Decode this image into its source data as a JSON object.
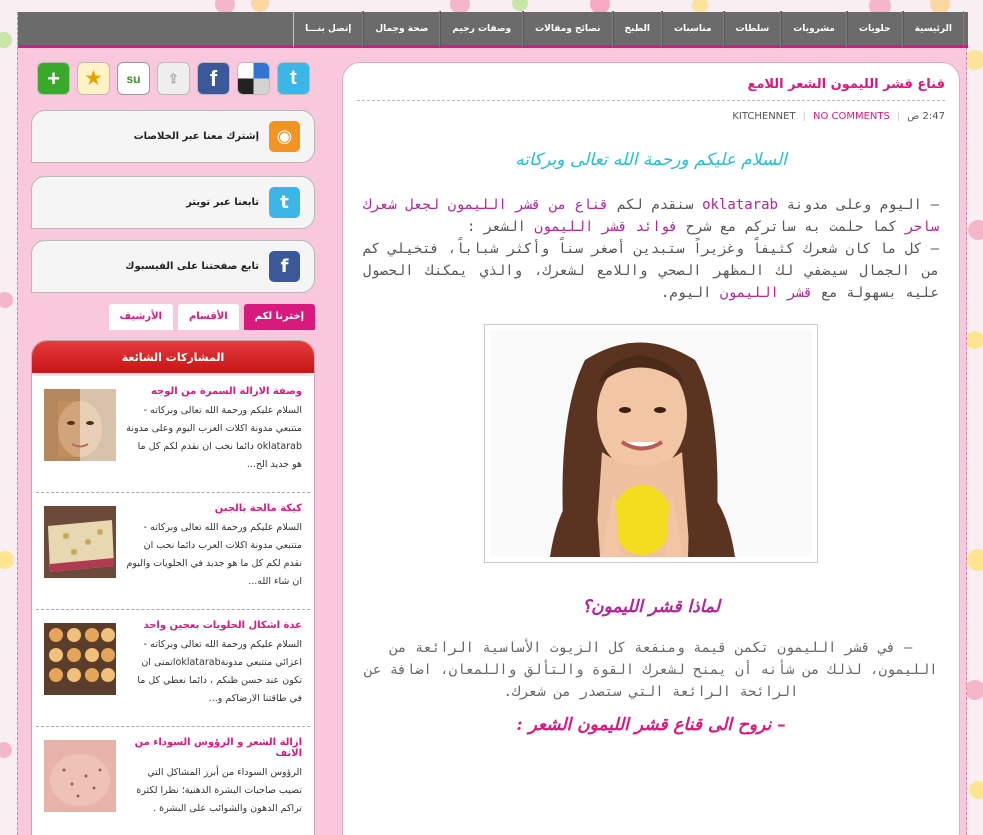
{
  "nav": {
    "items": [
      "الرئيسية",
      "حلويات",
      "مشروبات",
      "سلطات",
      "مناسبات",
      "الطبخ",
      "نصائح ومقالات",
      "وصفات رجيم",
      "صحة وجمال",
      "إتصل بنـــا"
    ]
  },
  "post": {
    "title": "قناع قشر الليمون الشعر اللامع",
    "time": "2:47 ص",
    "author": "KITCHENNET",
    "comments": "NO COMMENTS",
    "greeting": "السلام عليكم ورحمة الله تعالى وبركاته",
    "p1_a": "– اليوم وعلى مدونة ",
    "p1_blog": "oklatarab",
    "p1_b": " سنقدم لكم ",
    "p1_link1": "قناع من قشر الليمون لجعل شعرك ساحر",
    "p1_c": " كما حلمت به ساتركم مع شرح ",
    "p1_link2": "فوائد قشر الليمون",
    "p1_d": " الشعر :",
    "p2_a": "– كل ما كان شعرك كثيفاً وغزيراً ستبدين أصغر سناً وأكثر شباباً، فتخيلي كم من الجمال سيضفي لك المظهر الصحي واللامع لشعرك، والذي يمكنك الحصول عليه بسهولة مع ",
    "p2_link": "قشر الليمون",
    "p2_b": " اليوم.",
    "h_why": "لماذا قشر الليمون؟",
    "p3": "– في قشر الليمون تكمن قيمة ومنفعة كل الزيوت الأساسية الرائعة من الليمون، لذلك من شأنه أن يمنح لشعرك القوة والتألق واللمعان، اضافة عن الرائحة الرائعة التي ستصدر من شعرك.",
    "h_next": "– نروح الى قناع قشر الليمون الشعر :"
  },
  "sidebar": {
    "social_icons": [
      "twitter-icon",
      "delicious-icon",
      "facebook-icon",
      "share-icon",
      "stumbleupon-icon",
      "favorite-icon",
      "add-icon"
    ],
    "rss_label": "إشترك معنا عبر الخلاصات",
    "twitter_label": "تابعنا عبر تويتر",
    "facebook_label": "تابع صفحتنا على الفيسبوك",
    "tabs": [
      "إخترنا لكم",
      "الأقسام",
      "الأرشيف"
    ],
    "popular_title": "المشاركات الشائعة",
    "popular": [
      {
        "title": "وصفة الازالة السمرة من الوجه",
        "excerpt": "السلام عليكم ورحمة الله تعالى وبركاته - متتبعي مدونة اكلات العرب اليوم وعلى مدونة oklatarab دائما نحب ان نقدم لكم كل ما هو جديد الح..."
      },
      {
        "title": "كيكة مالحة بالجبن",
        "excerpt": "السلام عليكم ورحمة الله تعالى وبركاته - متتبعي مدونة اكلات العرب دائما نحب ان نقدم لكم كل ما هو جديد في الحلويات واليوم ان شاء الله..."
      },
      {
        "title": "عدة اشكال الحلويات بعجين واحد",
        "excerpt": "السلام عليكم ورحمة الله تعالى وبركاته - اعزائي متتبعي مدونةoklatarabاتمنى ان تكون عند حسن ظنكم ، دائما نعطي كل ما في طاقتنا الارضاكم و..."
      },
      {
        "title": "ازالة الشعر و الرؤوس السوداء من الانف",
        "excerpt": "الرؤوس السوداء من أبرز المشاكل التي تصيب صاحبات البشرة الدهنية؛ نظرا لكثرة تراكم الدهون والشوائب على البشرة ."
      }
    ]
  }
}
